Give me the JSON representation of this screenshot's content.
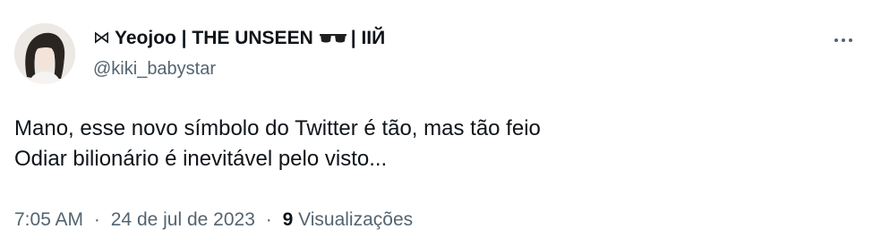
{
  "author": {
    "display_name_prefix": "⋈",
    "display_name": "Yeojoo | THE UNSEEN",
    "display_name_suffix": "| ΙΙЙ",
    "handle": "@kiki_babystar"
  },
  "tweet": {
    "lines": [
      "Mano, esse novo símbolo do Twitter é tão, mas tão feio",
      "Odiar bilionário é inevitável pelo visto..."
    ]
  },
  "meta": {
    "time": "7:05 AM",
    "separator": "·",
    "date": "24 de jul de 2023",
    "views_count": "9",
    "views_label": "Visualizações"
  },
  "icons": {
    "more": "more-horizontal-icon",
    "glasses": "sunglasses-emoji-icon"
  },
  "colors": {
    "text_primary": "#0f1419",
    "text_secondary": "#536471"
  }
}
